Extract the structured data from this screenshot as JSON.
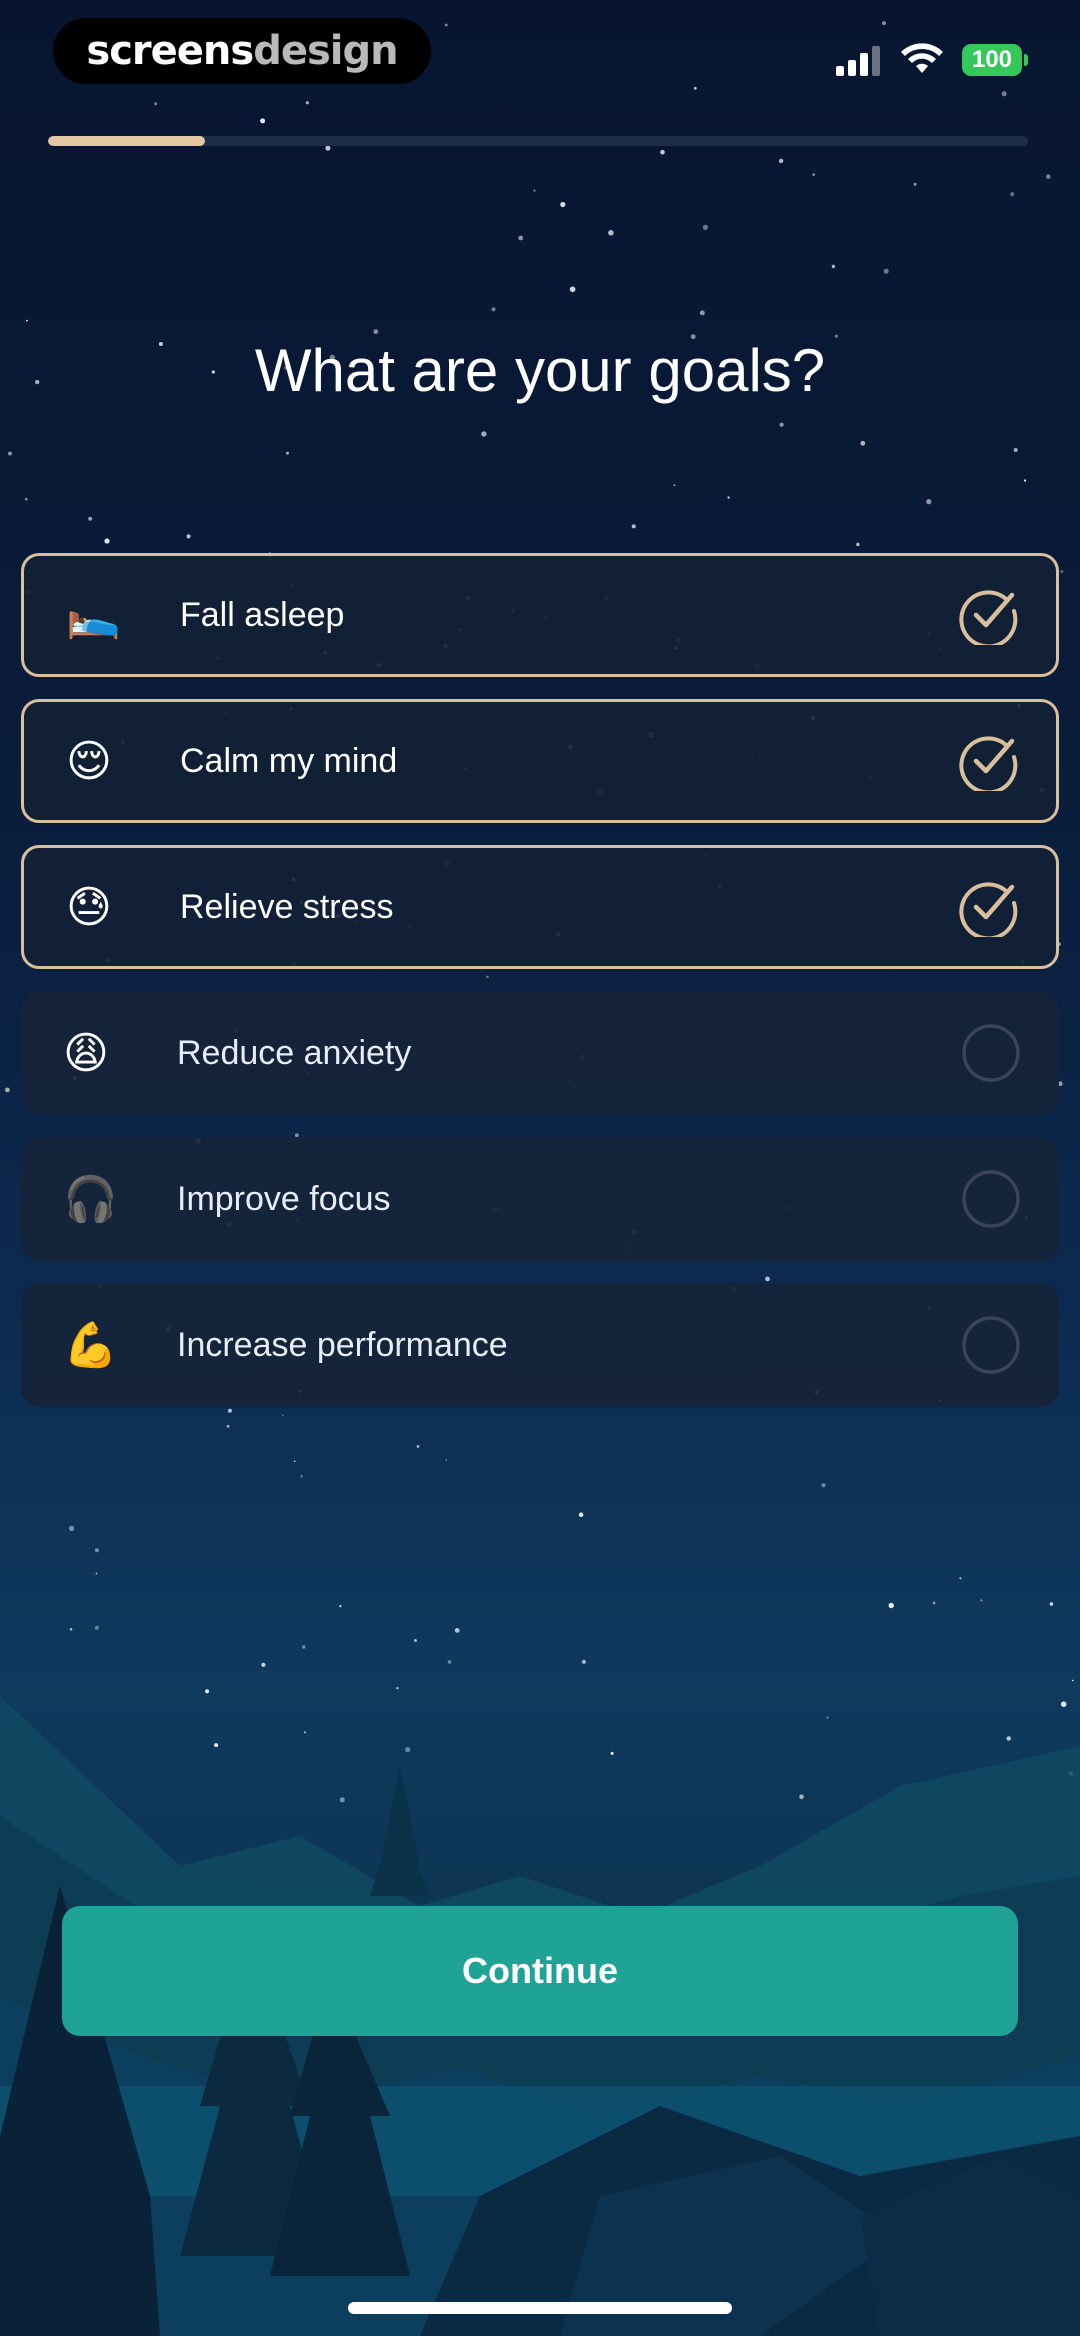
{
  "status_bar": {
    "brand_part1": "screens",
    "brand_part2": "design",
    "battery": "100",
    "signal_icon": "cellular-signal-icon",
    "wifi_icon": "wifi-icon"
  },
  "progress": {
    "value": 0.16,
    "color": "#e3c7a2"
  },
  "title": "What are your goals?",
  "options": [
    {
      "emoji": "🛌",
      "label": "Fall asleep",
      "selected": true
    },
    {
      "emoji": "😌",
      "label": "Calm my mind",
      "selected": true
    },
    {
      "emoji": "😓",
      "label": "Relieve stress",
      "selected": true
    },
    {
      "emoji": "😩",
      "label": "Reduce anxiety",
      "selected": false
    },
    {
      "emoji": "🎧",
      "label": "Improve focus",
      "selected": false
    },
    {
      "emoji": "💪",
      "label": "Increase performance",
      "selected": false
    }
  ],
  "continue_label": "Continue",
  "colors": {
    "accent": "#1fa396",
    "selected_border": "#d9bf9c",
    "battery": "#34c759"
  }
}
